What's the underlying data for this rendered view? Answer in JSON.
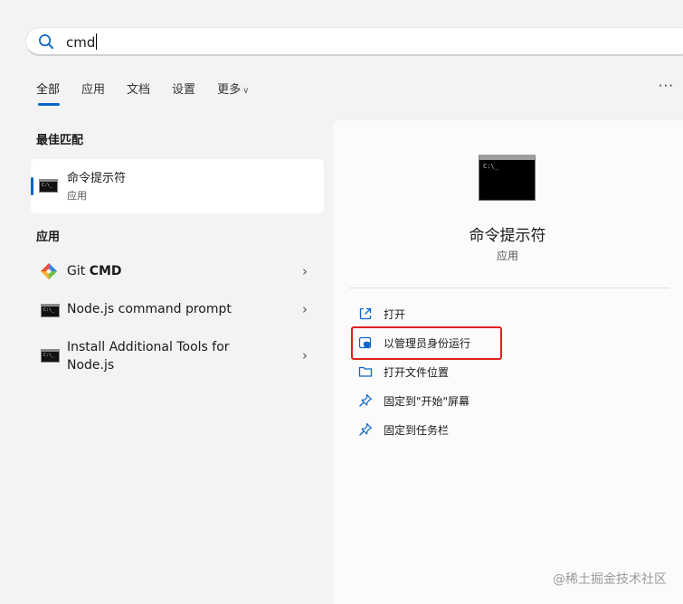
{
  "search": {
    "query": "cmd"
  },
  "tabs": [
    {
      "label": "全部",
      "active": true
    },
    {
      "label": "应用"
    },
    {
      "label": "文档"
    },
    {
      "label": "设置"
    },
    {
      "label": "更多"
    }
  ],
  "more_menu": "···",
  "best_match": {
    "section_title": "最佳匹配",
    "name": "命令提示符",
    "type": "应用"
  },
  "apps": {
    "section_title": "应用",
    "items": [
      {
        "name_prefix": "Git ",
        "name_bold": "CMD",
        "icon": "git-icon"
      },
      {
        "name": "Node.js command prompt",
        "icon": "cmd-icon"
      },
      {
        "name_line1": "Install Additional Tools for",
        "name_line2": "Node.js",
        "icon": "cmd-icon"
      }
    ]
  },
  "detail": {
    "name": "命令提示符",
    "type": "应用",
    "actions": [
      {
        "label": "打开",
        "icon": "open-icon"
      },
      {
        "label": "以管理员身份运行",
        "icon": "shield-icon"
      },
      {
        "label": "打开文件位置",
        "icon": "folder-icon"
      },
      {
        "label": "固定到\"开始\"屏幕",
        "icon": "pin-icon"
      },
      {
        "label": "固定到任务栏",
        "icon": "pin-icon"
      }
    ]
  },
  "accent_color": "#0a64c9",
  "highlight_color": "#e0201e",
  "watermark": "@稀土掘金技术社区"
}
